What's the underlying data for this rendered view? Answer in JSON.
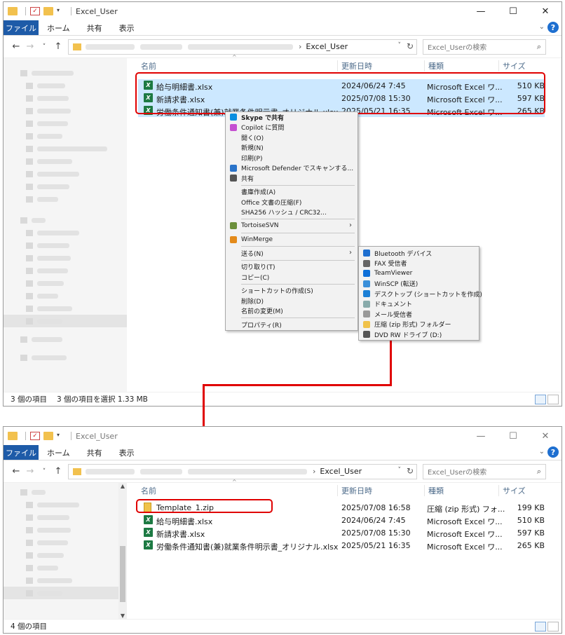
{
  "window1": {
    "title": "Excel_User",
    "tabs": [
      "ファイル",
      "ホーム",
      "共有",
      "表示"
    ],
    "address_current": "Excel_User",
    "search_placeholder": "Excel_Userの検索",
    "columns": {
      "name": "名前",
      "date": "更新日時",
      "type": "種類",
      "size": "サイズ"
    },
    "files": [
      {
        "name": "給与明細書.xlsx",
        "date": "2024/06/24 7:45",
        "type": "Microsoft Excel ワ...",
        "size": "510 KB"
      },
      {
        "name": "新請求書.xlsx",
        "date": "2025/07/08 15:30",
        "type": "Microsoft Excel ワ...",
        "size": "597 KB"
      },
      {
        "name": "労働条件通知書(兼)就業条件明示書_オリジナル.xlsx",
        "date": "2025/05/21 16:35",
        "type": "Microsoft Excel ワ...",
        "size": "265 KB"
      }
    ],
    "status": {
      "count": "3 個の項目",
      "selected": "3 個の項目を選択 1.33 MB"
    }
  },
  "context_menu": {
    "items": [
      {
        "label": "Skype で共有",
        "icon": "skype-icon",
        "color": "#0a8ee0",
        "bold": true
      },
      {
        "label": "Copilot に質問",
        "icon": "copilot-icon",
        "color": "#c54fd1"
      },
      {
        "label": "開く(O)"
      },
      {
        "label": "新規(N)"
      },
      {
        "label": "印刷(P)"
      },
      {
        "label": "Microsoft Defender でスキャンする...",
        "icon": "defender-icon",
        "color": "#2a73c9"
      },
      {
        "label": "共有",
        "icon": "share-icon",
        "color": "#555"
      },
      {
        "sep": true
      },
      {
        "label": "書庫作成(A)"
      },
      {
        "label": "Office 文書の圧縮(F)"
      },
      {
        "label": "SHA256 ハッシュ / CRC32..."
      },
      {
        "sep": true
      },
      {
        "label": "TortoiseSVN",
        "icon": "tortoisesvn-icon",
        "color": "#6b8f3a",
        "arrow": true
      },
      {
        "sep": true
      },
      {
        "label": "WinMerge",
        "icon": "winmerge-icon",
        "color": "#e38a1a"
      },
      {
        "sep": true
      },
      {
        "label": "送る(N)",
        "arrow": true
      },
      {
        "sep": true
      },
      {
        "label": "切り取り(T)"
      },
      {
        "label": "コピー(C)"
      },
      {
        "sep": true
      },
      {
        "label": "ショートカットの作成(S)"
      },
      {
        "label": "削除(D)"
      },
      {
        "label": "名前の変更(M)"
      },
      {
        "sep": true
      },
      {
        "label": "プロパティ(R)"
      }
    ]
  },
  "sendto_menu": {
    "items": [
      {
        "label": "Bluetooth デバイス",
        "icon": "bluetooth-icon",
        "color": "#1e6fd0"
      },
      {
        "label": "FAX 受信者",
        "icon": "fax-icon",
        "color": "#666"
      },
      {
        "label": "TeamViewer",
        "icon": "teamviewer-icon",
        "color": "#0e6fd8"
      },
      {
        "label": "WinSCP (転送)",
        "icon": "winscp-icon",
        "color": "#3a8fd9"
      },
      {
        "label": "デスクトップ (ショートカットを作成)",
        "icon": "desktop-icon",
        "color": "#1b7fd6"
      },
      {
        "label": "ドキュメント",
        "icon": "documents-icon",
        "color": "#8aa"
      },
      {
        "label": "メール受信者",
        "icon": "mail-icon",
        "color": "#999"
      },
      {
        "label": "圧縮 (zip 形式) フォルダー",
        "icon": "zip-folder-icon",
        "color": "#f0c24a"
      },
      {
        "label": "DVD RW ドライブ (D:)",
        "icon": "dvd-drive-icon",
        "color": "#555"
      }
    ]
  },
  "window2": {
    "title": "Excel_User",
    "tabs": [
      "ファイル",
      "ホーム",
      "共有",
      "表示"
    ],
    "address_current": "Excel_User",
    "search_placeholder": "Excel_Userの検索",
    "columns": {
      "name": "名前",
      "date": "更新日時",
      "type": "種類",
      "size": "サイズ"
    },
    "files": [
      {
        "name": "Template_1.zip",
        "date": "2025/07/08 16:58",
        "type": "圧縮 (zip 形式) フォ...",
        "size": "199 KB",
        "kind": "zip"
      },
      {
        "name": "給与明細書.xlsx",
        "date": "2024/06/24 7:45",
        "type": "Microsoft Excel ワ...",
        "size": "510 KB"
      },
      {
        "name": "新請求書.xlsx",
        "date": "2025/07/08 15:30",
        "type": "Microsoft Excel ワ...",
        "size": "597 KB"
      },
      {
        "name": "労働条件通知書(兼)就業条件明示書_オリジナル.xlsx",
        "date": "2025/05/21 16:35",
        "type": "Microsoft Excel ワ...",
        "size": "265 KB"
      }
    ],
    "status": {
      "count": "4 個の項目"
    }
  },
  "colors": {
    "accent": "#1e5ba8",
    "highlight": "#e00000",
    "selection": "#cce8ff"
  }
}
